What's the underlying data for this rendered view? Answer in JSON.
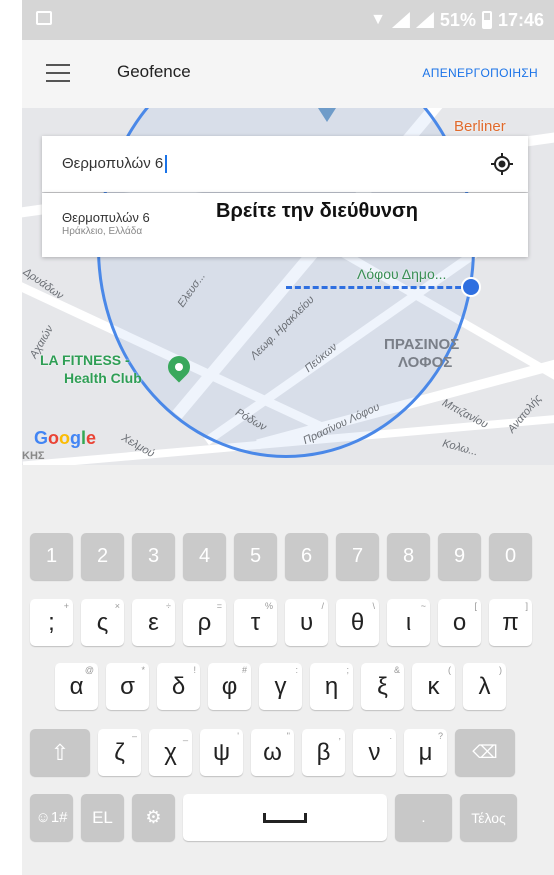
{
  "status": {
    "battery": "51%",
    "time": "17:46"
  },
  "appbar": {
    "title": "Geofence",
    "action": "ΑΠΕΝΕΡΓΟΠΟΙΗΣΗ"
  },
  "search": {
    "value": "Θερμοπυλών 6"
  },
  "suggestion": {
    "main": "Θερμοπυλών 6",
    "sub": "Ηράκλειο, Ελλάδα"
  },
  "overlay": {
    "caption": "Βρείτε την διεύθυνση"
  },
  "map": {
    "labels": {
      "berliner": "Berliner",
      "lofos": "Λόφου Δημο...",
      "fitness1": "LA FITNESS -",
      "fitness2": "Health Club",
      "area1": "ΠΡΑΣΙΝΟΣ",
      "area2": "ΛΟΦΟΣ",
      "google": "Google",
      "st_irakliou": "Λεωφ. Ηρακλείου",
      "st_eleftherias": "Ελευσ...",
      "st_peukon": "Πεύκων",
      "st_rodon": "Ρόδων",
      "st_prasinou": "Πρασίνου Λόφου",
      "st_mpizaniou": "Μπιζανίου",
      "st_anatolis": "Ανατολής",
      "st_kolon": "Κολω...",
      "st_xelmou": "Χελμού",
      "st_droudeon": "Δρυάδων",
      "st_axaion": "Αχαιών",
      "khs": "ΚΗΣ"
    }
  },
  "keyboard": {
    "numbers": [
      "1",
      "2",
      "3",
      "4",
      "5",
      "6",
      "7",
      "8",
      "9",
      "0"
    ],
    "row1": [
      {
        "k": ";",
        "s": "+"
      },
      {
        "k": "ς",
        "s": "×"
      },
      {
        "k": "ε",
        "s": "÷"
      },
      {
        "k": "ρ",
        "s": "="
      },
      {
        "k": "τ",
        "s": "%"
      },
      {
        "k": "υ",
        "s": "/"
      },
      {
        "k": "θ",
        "s": "\\"
      },
      {
        "k": "ι",
        "s": "~"
      },
      {
        "k": "ο",
        "s": "["
      },
      {
        "k": "π",
        "s": "]"
      }
    ],
    "row2": [
      {
        "k": "α",
        "s": "@"
      },
      {
        "k": "σ",
        "s": "*"
      },
      {
        "k": "δ",
        "s": "!"
      },
      {
        "k": "φ",
        "s": "#"
      },
      {
        "k": "γ",
        "s": ":"
      },
      {
        "k": "η",
        "s": ";"
      },
      {
        "k": "ξ",
        "s": "&"
      },
      {
        "k": "κ",
        "s": "("
      },
      {
        "k": "λ",
        "s": ")"
      }
    ],
    "row3": [
      {
        "k": "ζ",
        "s": "–"
      },
      {
        "k": "χ",
        "s": "_"
      },
      {
        "k": "ψ",
        "s": "'"
      },
      {
        "k": "ω",
        "s": "\""
      },
      {
        "k": "β",
        "s": ","
      },
      {
        "k": "ν",
        "s": "."
      },
      {
        "k": "μ",
        "s": "?"
      }
    ],
    "bottom": {
      "sym": "☺1#",
      "lang": "EL",
      "period": ".",
      "done": "Τέλος"
    }
  }
}
